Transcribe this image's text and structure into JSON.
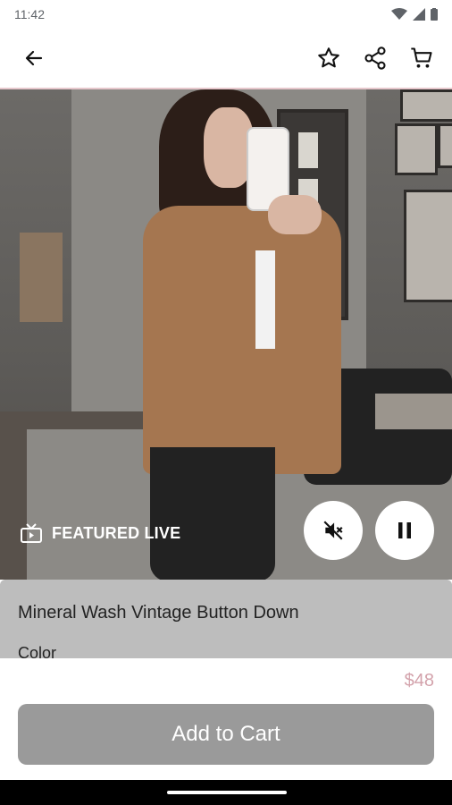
{
  "status_bar": {
    "time": "11:42"
  },
  "app_bar": {
    "back_icon": "arrow-left-icon",
    "favorite_icon": "star-outline-icon",
    "share_icon": "share-icon",
    "cart_icon": "cart-icon"
  },
  "video": {
    "featured_label": "FEATURED LIVE",
    "mute_icon": "volume-off-icon",
    "pause_icon": "pause-icon"
  },
  "product": {
    "title": "Mineral Wash Vintage Button Down",
    "color_label": "Color",
    "price": "$48",
    "add_to_cart_label": "Add to Cart"
  },
  "colors": {
    "accent_pink": "#d3a2ab",
    "button_gray": "#9a9a9a",
    "sheet_gray": "#bdbdbd"
  }
}
